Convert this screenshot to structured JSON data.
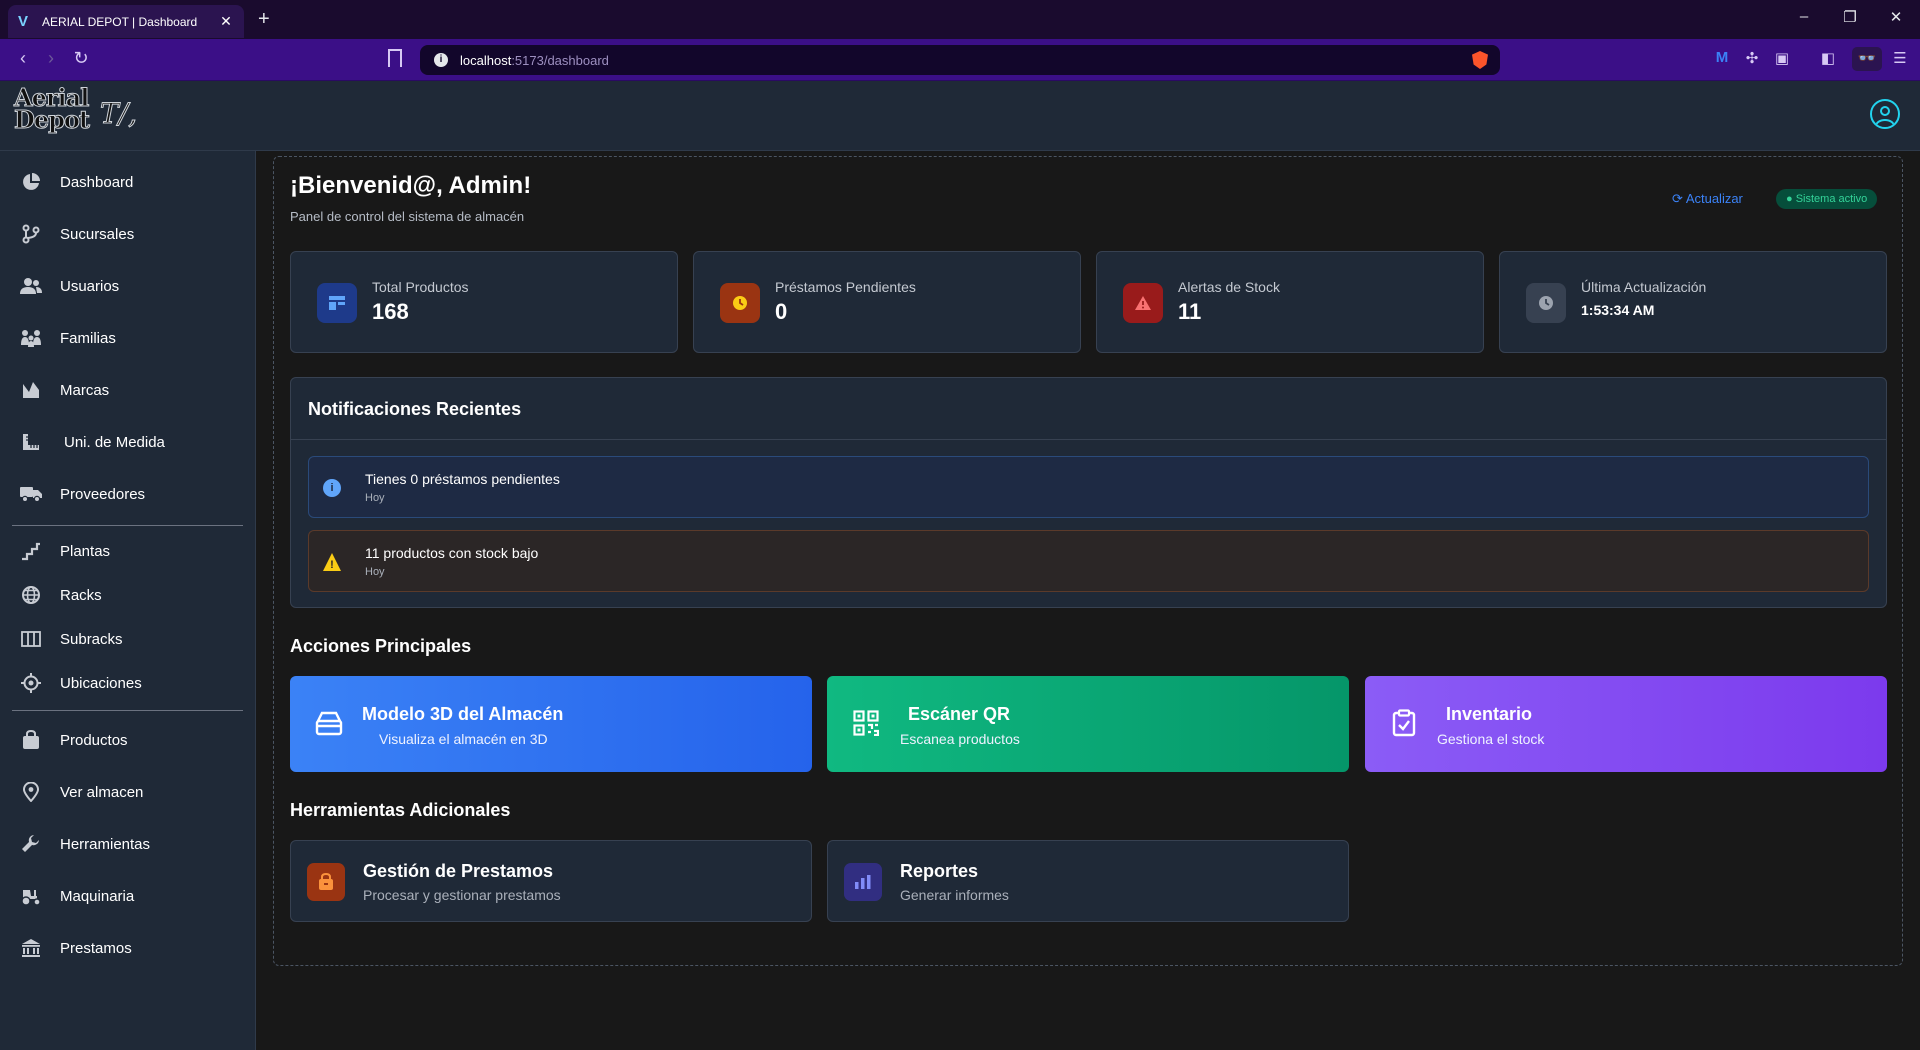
{
  "browser": {
    "tab_title": "AERIAL DEPOT | Dashboard",
    "url_host": "localhost",
    "url_path": ":5173/dashboard"
  },
  "app": {
    "logo_text_line1": "Aerial",
    "logo_text_line2": "Depot"
  },
  "sidebar": {
    "items": [
      {
        "label": "Dashboard",
        "icon": "pie-chart-icon"
      },
      {
        "label": "Sucursales",
        "icon": "branches-icon"
      },
      {
        "label": "Usuarios",
        "icon": "users-icon"
      },
      {
        "label": "Familias",
        "icon": "family-icon"
      },
      {
        "label": "Marcas",
        "icon": "brand-icon"
      },
      {
        "label": "Uni. de Medida",
        "icon": "ruler-icon"
      },
      {
        "label": "Proveedores",
        "icon": "truck-icon"
      },
      {
        "label": "Plantas",
        "icon": "stairs-icon"
      },
      {
        "label": "Racks",
        "icon": "globe-icon"
      },
      {
        "label": "Subracks",
        "icon": "columns-icon"
      },
      {
        "label": "Ubicaciones",
        "icon": "target-icon"
      },
      {
        "label": "Productos",
        "icon": "bag-icon"
      },
      {
        "label": "Ver almacen",
        "icon": "location-pin-icon"
      },
      {
        "label": "Herramientas",
        "icon": "wrench-icon"
      },
      {
        "label": "Maquinaria",
        "icon": "tractor-icon"
      },
      {
        "label": "Prestamos",
        "icon": "bank-icon"
      }
    ]
  },
  "dashboard": {
    "welcome": "¡Bienvenid@, Admin!",
    "subtitle": "Panel de control del sistema de almacén",
    "refresh_label": "Actualizar",
    "status_label": "Sistema activo",
    "stats": [
      {
        "label": "Total Productos",
        "value": "168",
        "color": "#1e3a8a",
        "icon": "table-icon"
      },
      {
        "label": "Préstamos Pendientes",
        "value": "0",
        "color": "#9a3412",
        "icon": "clock-icon"
      },
      {
        "label": "Alertas de Stock",
        "value": "11",
        "color": "#991b1b",
        "icon": "alert-icon"
      },
      {
        "label": "Última Actualización",
        "value": "1:53:34 AM",
        "color": "#374151",
        "icon": "clock-icon"
      }
    ],
    "notifications_title": "Notificaciones Recientes",
    "notifications": [
      {
        "text": "Tienes 0 préstamos pendientes",
        "time": "Hoy",
        "type": "info"
      },
      {
        "text": "11 productos con stock bajo",
        "time": "Hoy",
        "type": "warning"
      }
    ],
    "actions_title": "Acciones Principales",
    "actions": [
      {
        "title": "Modelo 3D del Almacén",
        "subtitle": "Visualiza el almacén en 3D",
        "icon": "warehouse-icon"
      },
      {
        "title": "Escáner QR",
        "subtitle": "Escanea productos",
        "icon": "qr-icon"
      },
      {
        "title": "Inventario",
        "subtitle": "Gestiona el stock",
        "icon": "clipboard-check-icon"
      }
    ],
    "tools_title": "Herramientas Adicionales",
    "tools": [
      {
        "title": "Gestión de Prestamos",
        "subtitle": "Procesar y gestionar prestamos",
        "icon": "package-icon",
        "color": "#9a3412"
      },
      {
        "title": "Reportes",
        "subtitle": "Generar informes",
        "icon": "bar-chart-icon",
        "color": "#312e81"
      }
    ]
  }
}
